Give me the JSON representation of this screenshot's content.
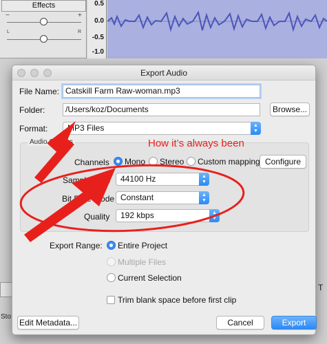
{
  "track": {
    "title": "Effects",
    "gain_minus": "−",
    "gain_plus": "+",
    "pan_left": "L",
    "pan_right": "R"
  },
  "vruler": [
    "0.5",
    "0.0",
    "-0.5",
    "-1.0"
  ],
  "background": {
    "partial_left": "Sto",
    "partial_right": "T"
  },
  "dialog": {
    "title": "Export Audio",
    "file_name_label": "File Name:",
    "file_name_value": "Catskill Farm Raw-woman.mp3",
    "folder_label": "Folder:",
    "folder_value": "/Users/koz/Documents",
    "browse_label": "Browse...",
    "format_label": "Format:",
    "format_value": "MP3 Files",
    "group_title": "Audio Options",
    "channels_label": "Channels",
    "channels_options": [
      "Mono",
      "Stereo",
      "Custom mapping"
    ],
    "configure_label": "Configure",
    "sample_rate_label": "Sample Rate",
    "sample_rate_value": "44100 Hz",
    "bit_rate_mode_label": "Bit Rate Mode",
    "bit_rate_mode_value": "Constant",
    "quality_label": "Quality",
    "quality_value": "192 kbps",
    "export_range_label": "Export Range:",
    "range_options": [
      "Entire Project",
      "Multiple Files",
      "Current Selection"
    ],
    "trim_label": "Trim blank space before first clip",
    "edit_metadata_label": "Edit Metadata...",
    "cancel_label": "Cancel",
    "export_label": "Export"
  },
  "annotation": {
    "text": "How it’s always been",
    "color": "#e8201c"
  }
}
